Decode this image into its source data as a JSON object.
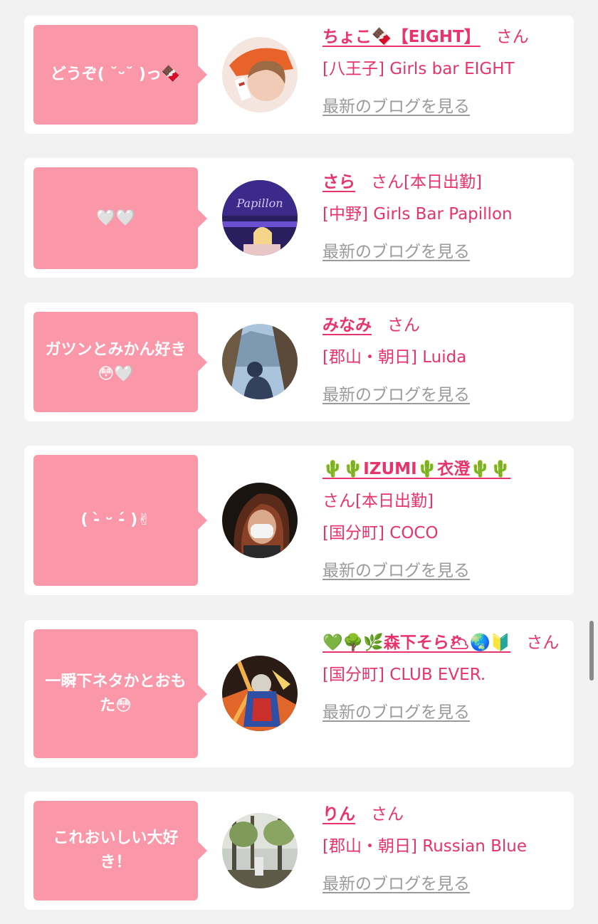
{
  "cards": [
    {
      "message": "どうぞ( ˘ᵕ˘ )っ🍫",
      "name": "ちょこ🍫【EIGHT】",
      "san": "さん",
      "status": "",
      "shop": "[八王子] Girls bar EIGHT",
      "blog_link": "最新のブログを見る"
    },
    {
      "message": "🤍🤍",
      "name": "さら",
      "san": "さん",
      "status": "[本日出勤]",
      "shop": "[中野] Girls Bar Papillon",
      "blog_link": "最新のブログを見る"
    },
    {
      "message": "ガツンとみかん好き😳🤍",
      "name": "みなみ",
      "san": "さん",
      "status": "",
      "shop": "[郡山・朝日] Luida",
      "blog_link": "最新のブログを見る"
    },
    {
      "message": "( -̀ ᵕ -́ )✌",
      "name": "🌵🌵IZUMI🌵衣澄🌵🌵",
      "san": "さん",
      "status": "[本日出勤]",
      "shop": "[国分町] COCO",
      "blog_link": "最新のブログを見る"
    },
    {
      "message": "一瞬下ネタかとおもた😳",
      "name": "💚🌳🌿森下そら🌥🌏🔰",
      "san": "さん",
      "status": "",
      "shop": "[国分町] CLUB EVER.",
      "blog_link": "最新のブログを見る"
    },
    {
      "message": "これおいしい大好き！",
      "name": "りん",
      "san": "さん",
      "status": "",
      "shop": "[郡山・朝日] Russian Blue",
      "blog_link": "最新のブログを見る"
    }
  ],
  "colors": {
    "page_background": "#f2f2f2",
    "card_background": "#ffffff",
    "bubble": "#fa97a8",
    "accent_pink": "#e8336b",
    "link_gray": "#9a9a9a"
  }
}
